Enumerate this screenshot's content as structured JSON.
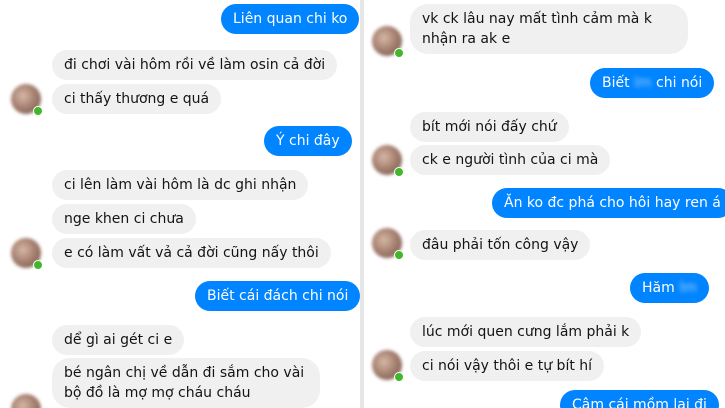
{
  "left_messages": [
    {
      "text": "Liên quan chi ko",
      "dir": "out"
    },
    {
      "text": "đi chơi vài hôm rồi về làm osin cả đời",
      "dir": "in"
    },
    {
      "text": "ci thấy thương e quá",
      "dir": "in"
    },
    {
      "text": "Ý chi đây",
      "dir": "out"
    },
    {
      "text": "ci lên làm vài hôm là dc ghi nhận",
      "dir": "in"
    },
    {
      "text": "nge khen ci chưa",
      "dir": "in"
    },
    {
      "text": "e có làm vất vả cả đời cũng nấy thôi",
      "dir": "in"
    },
    {
      "text": "Biết cái đách chi nói",
      "dir": "out"
    },
    {
      "text": "dể gì ai gét ci e",
      "dir": "in"
    },
    {
      "text": "bé ngân chị về dẫn đi sắm cho vài bộ đồ là mợ mợ cháu cháu",
      "dir": "in"
    }
  ],
  "right_messages": [
    {
      "text": "vk ck lâu nay mất tình cảm mà k nhận ra ak e",
      "dir": "in"
    },
    {
      "text_before": "Biết ",
      "text_blurred": "lm",
      "text_after": " chi nói",
      "dir": "out"
    },
    {
      "text": "bít mới nói đấy chứ",
      "dir": "in"
    },
    {
      "text": "ck e người tình của ci mà",
      "dir": "in"
    },
    {
      "text": "Ăn ko đc phá cho hôi hay ren á",
      "dir": "out"
    },
    {
      "text": "đâu phải tốn công vậy",
      "dir": "in"
    },
    {
      "text_before": "Hăm ",
      "text_blurred": "lm",
      "text_after": "",
      "dir": "out"
    },
    {
      "text": "lúc mới quen cưng lắm phải k",
      "dir": "in"
    },
    {
      "text": "ci nói vậy thôi e tự bít hí",
      "dir": "in"
    },
    {
      "text": "Câm cái mồm lại đi",
      "dir": "out"
    }
  ],
  "colors": {
    "outgoing_bubble": "#0084ff",
    "incoming_bubble": "#f1f0f0",
    "online_indicator": "#42b72a"
  },
  "icons": [
    "avatar-blurred",
    "online-status-dot"
  ]
}
